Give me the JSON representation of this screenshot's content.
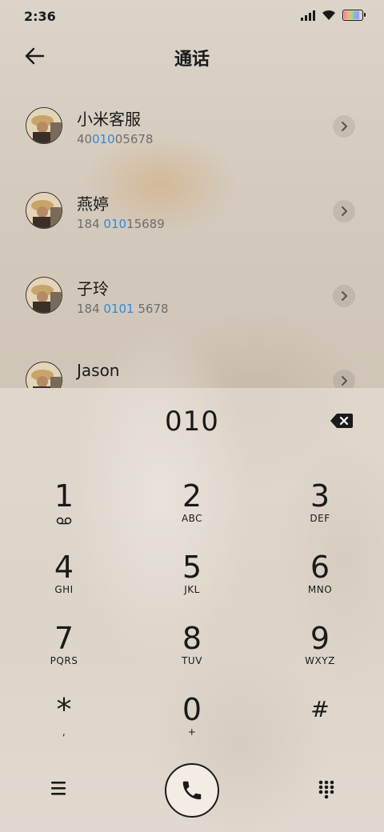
{
  "status_bar": {
    "time": "2:36"
  },
  "header": {
    "title": "通话"
  },
  "contacts": [
    {
      "name": "小米客服",
      "number_parts": [
        "40",
        "010",
        "05678"
      ]
    },
    {
      "name": "燕婷",
      "number_parts": [
        "184 ",
        "010",
        "15689"
      ]
    },
    {
      "name": "子玲",
      "number_parts": [
        "184 ",
        "0101",
        " 5678"
      ]
    },
    {
      "name": "Jason",
      "number_parts": [
        "",
        "",
        ""
      ]
    }
  ],
  "dialer": {
    "input": "010",
    "keys": [
      {
        "digit": "1",
        "letters": ""
      },
      {
        "digit": "2",
        "letters": "ABC"
      },
      {
        "digit": "3",
        "letters": "DEF"
      },
      {
        "digit": "4",
        "letters": "GHI"
      },
      {
        "digit": "5",
        "letters": "JKL"
      },
      {
        "digit": "6",
        "letters": "MNO"
      },
      {
        "digit": "7",
        "letters": "PQRS"
      },
      {
        "digit": "8",
        "letters": "TUV"
      },
      {
        "digit": "9",
        "letters": "WXYZ"
      },
      {
        "digit": "*",
        "letters": ","
      },
      {
        "digit": "0",
        "letters": "+"
      },
      {
        "digit": "#",
        "letters": ""
      }
    ]
  },
  "icons": {
    "back": "arrow-left-icon",
    "detail": "chevron-right-icon",
    "backspace": "backspace-icon",
    "voicemail": "voicemail-icon",
    "menu": "menu-icon",
    "call": "phone-icon",
    "keypad": "dialpad-icon"
  },
  "colors": {
    "highlight": "#2b8be0"
  }
}
